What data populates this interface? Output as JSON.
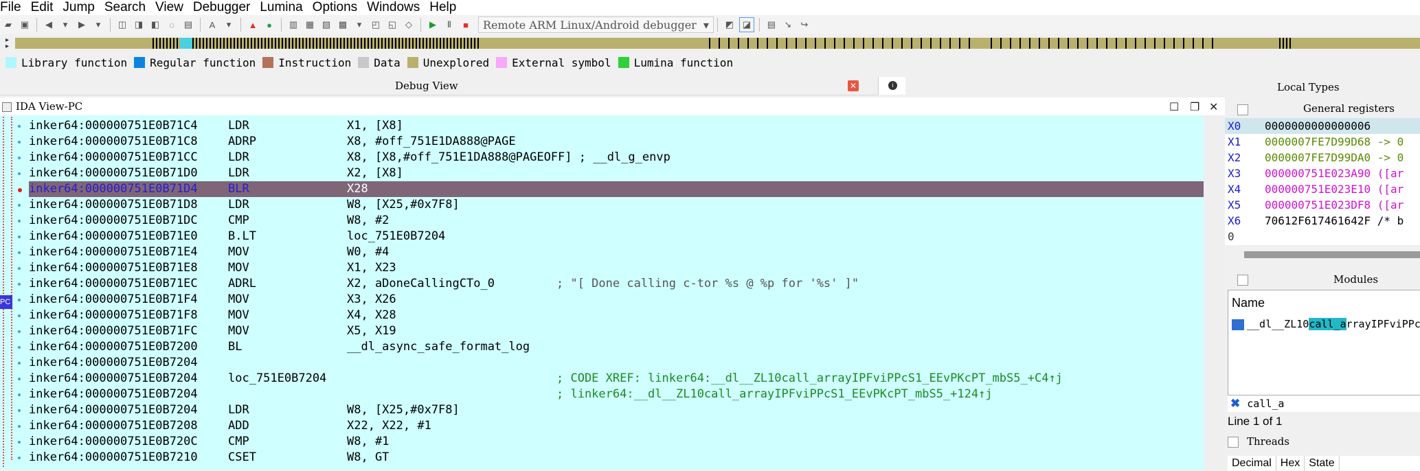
{
  "menu": [
    "File",
    "Edit",
    "Jump",
    "Search",
    "View",
    "Debugger",
    "Lumina",
    "Options",
    "Windows",
    "Help"
  ],
  "toolbar": {
    "debugger_select": "Remote ARM Linux/Android debugger"
  },
  "legend": [
    {
      "label": "Library function",
      "color": "#aef8fc"
    },
    {
      "label": "Regular function",
      "color": "#0a84e0"
    },
    {
      "label": "Instruction",
      "color": "#b5725b"
    },
    {
      "label": "Data",
      "color": "#c8c8c8"
    },
    {
      "label": "Unexplored",
      "color": "#b9b06d"
    },
    {
      "label": "External symbol",
      "color": "#f8a8f8"
    },
    {
      "label": "Lumina function",
      "color": "#2fd03a"
    }
  ],
  "panels": {
    "debug_view": "Debug View",
    "local_types": "Local Types",
    "ida_view": "IDA View-PC",
    "general_registers": "General registers",
    "modules": "Modules",
    "threads": "Threads"
  },
  "pc_label": "PC",
  "code_rows": [
    {
      "addr": "inker64:000000751E0B71C4",
      "op": "LDR",
      "arg": "X1, [X8]",
      "cmt": ""
    },
    {
      "addr": "inker64:000000751E0B71C8",
      "op": "ADRP",
      "arg": "X8, #off_751E1DA888@PAGE",
      "cmt": ""
    },
    {
      "addr": "inker64:000000751E0B71CC",
      "op": "LDR",
      "arg": "X8, [X8,#off_751E1DA888@PAGEOFF] ; __dl_g_envp",
      "cmt": ""
    },
    {
      "addr": "inker64:000000751E0B71D0",
      "op": "LDR",
      "arg": "X2, [X8]",
      "cmt": ""
    },
    {
      "addr": "inker64:000000751E0B71D4",
      "op": "BLR",
      "arg": "X28",
      "cmt": "",
      "hl": true
    },
    {
      "addr": "inker64:000000751E0B71D8",
      "op": "LDR",
      "arg": "W8, [X25,#0x7F8]",
      "cmt": ""
    },
    {
      "addr": "inker64:000000751E0B71DC",
      "op": "CMP",
      "arg": "W8, #2",
      "cmt": ""
    },
    {
      "addr": "inker64:000000751E0B71E0",
      "op": "B.LT",
      "arg": "loc_751E0B7204",
      "cmt": ""
    },
    {
      "addr": "inker64:000000751E0B71E4",
      "op": "MOV",
      "arg": "W0, #4",
      "cmt": ""
    },
    {
      "addr": "inker64:000000751E0B71E8",
      "op": "MOV",
      "arg": "X1, X23",
      "cmt": ""
    },
    {
      "addr": "inker64:000000751E0B71EC",
      "op": "ADRL",
      "arg": "X2, aDoneCallingCTo_0",
      "cmt": "; \"[ Done calling c-tor %s @ %p for '%s' ]\"",
      "gray": true
    },
    {
      "addr": "inker64:000000751E0B71F4",
      "op": "MOV",
      "arg": "X3, X26",
      "cmt": ""
    },
    {
      "addr": "inker64:000000751E0B71F8",
      "op": "MOV",
      "arg": "X4, X28",
      "cmt": ""
    },
    {
      "addr": "inker64:000000751E0B71FC",
      "op": "MOV",
      "arg": "X5, X19",
      "cmt": ""
    },
    {
      "addr": "inker64:000000751E0B7200",
      "op": "BL",
      "arg": "__dl_async_safe_format_log",
      "cmt": ""
    },
    {
      "addr": "inker64:000000751E0B7204",
      "op": "",
      "arg": "",
      "cmt": ""
    },
    {
      "addr": "inker64:000000751E0B7204",
      "op": "loc_751E0B7204",
      "arg": "",
      "cmt": "; CODE XREF: linker64:__dl__ZL10call_arrayIPFviPPcS1_EEvPKcPT_mbS5_+C4↑j"
    },
    {
      "addr": "inker64:000000751E0B7204",
      "op": "",
      "arg": "",
      "cmt": "; linker64:__dl__ZL10call_arrayIPFviPPcS1_EEvPKcPT_mbS5_+124↑j"
    },
    {
      "addr": "inker64:000000751E0B7204",
      "op": "LDR",
      "arg": "W8, [X25,#0x7F8]",
      "cmt": ""
    },
    {
      "addr": "inker64:000000751E0B7208",
      "op": "ADD",
      "arg": "X22, X22, #1",
      "cmt": ""
    },
    {
      "addr": "inker64:000000751E0B720C",
      "op": "CMP",
      "arg": "W8, #1",
      "cmt": ""
    },
    {
      "addr": "inker64:000000751E0B7210",
      "op": "CSET",
      "arg": "W8, GT",
      "cmt": ""
    },
    {
      "addr": "",
      "op": "",
      "arg": "",
      "cmt": ""
    }
  ],
  "registers": [
    {
      "name": "X0",
      "value": "0000000000000006",
      "color": "#000000",
      "sel": true
    },
    {
      "name": "X1",
      "value": "0000007FE7D99D68 -> 0",
      "color": "#5a8a00"
    },
    {
      "name": "X2",
      "value": "0000007FE7D99DA0 -> 0",
      "color": "#5a8a00"
    },
    {
      "name": "X3",
      "value": "000000751E023A90 ([ar",
      "color": "#d010d0"
    },
    {
      "name": "X4",
      "value": "000000751E023E10 ([ar",
      "color": "#d010d0"
    },
    {
      "name": "X5",
      "value": "000000751E023DF8 ([ar",
      "color": "#d010d0"
    },
    {
      "name": "X6",
      "value": "70612F617461642F /* b",
      "color": "#000000"
    }
  ],
  "reg_footer": "0",
  "modules": {
    "column": "Name",
    "item_pre": "__dl__ZL10",
    "item_hi": "call_a",
    "item_post": "rrayIPFviPPc"
  },
  "filter": {
    "value": "call_a"
  },
  "line_info": "Line 1 of 1",
  "threads_columns": [
    "Decimal",
    "Hex",
    "State"
  ]
}
